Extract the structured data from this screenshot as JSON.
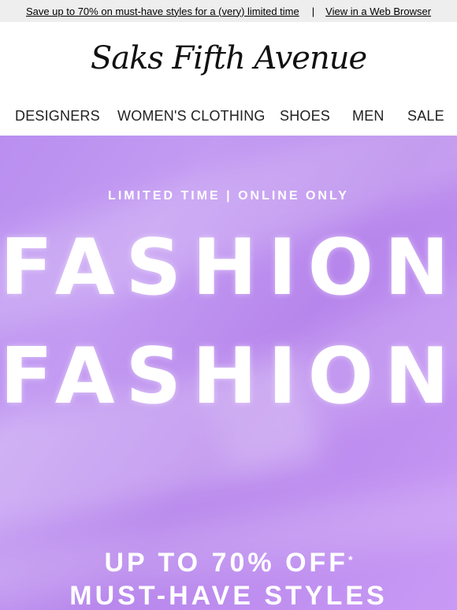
{
  "topbar": {
    "promo_link": "Save up to 70% on must-have styles for a (very) limited time",
    "separator": "|",
    "browser_link": "View in a Web Browser"
  },
  "brand": {
    "logo_text": "Saks Fifth Avenue"
  },
  "nav": {
    "items": [
      {
        "label": "DESIGNERS"
      },
      {
        "label": "WOMEN'S CLOTHING"
      },
      {
        "label": "SHOES"
      },
      {
        "label": "MEN"
      },
      {
        "label": "SALE"
      }
    ]
  },
  "hero": {
    "kicker": "LIMITED TIME | ONLINE ONLY",
    "title_line1": "FASHION",
    "title_line2": "FASHION",
    "promo_line1": "UP TO 70% OFF",
    "promo_asterisk": "*",
    "promo_line2": "MUST-HAVE STYLES",
    "colors": {
      "background": "#bf94f1",
      "text": "#ffffff"
    }
  }
}
